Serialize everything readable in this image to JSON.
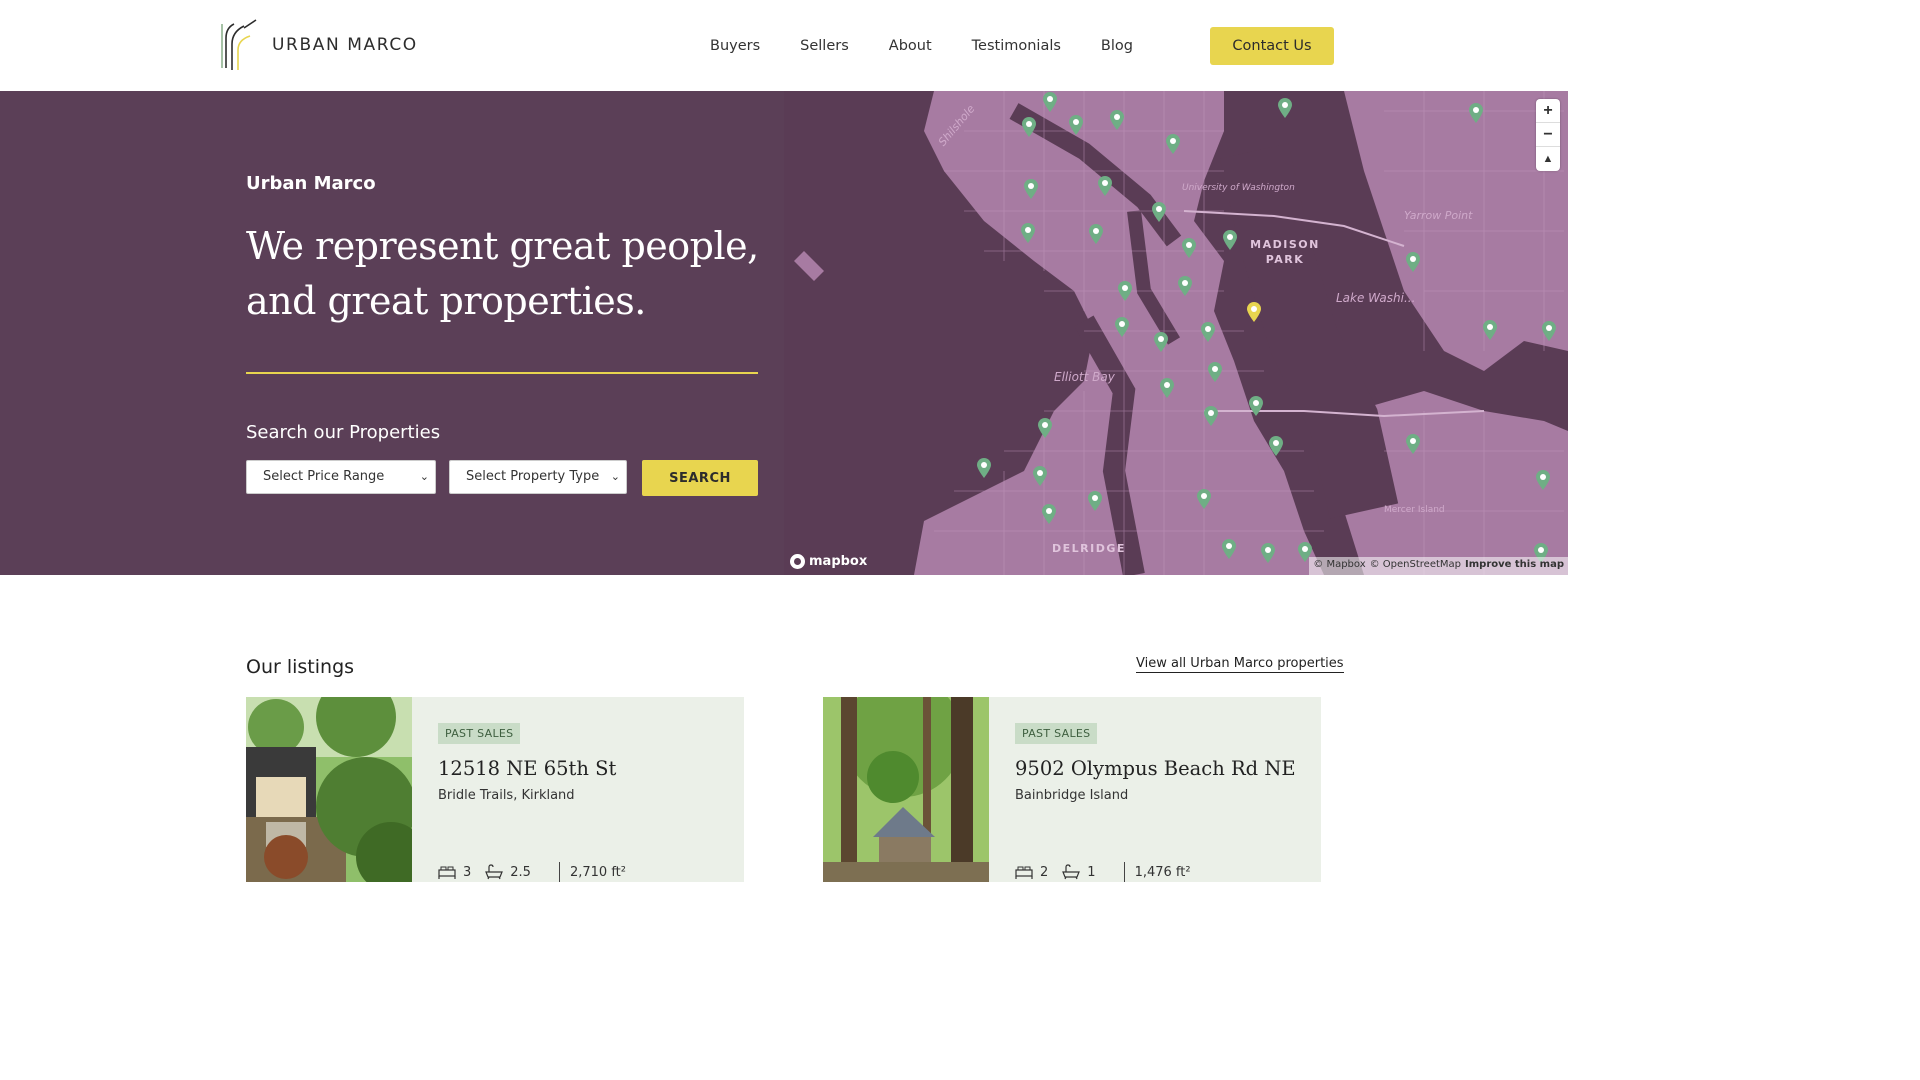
{
  "header": {
    "logo_text": "URBAN MARCO",
    "nav": [
      "Buyers",
      "Sellers",
      "About",
      "Testimonials",
      "Blog"
    ],
    "contact_label": "Contact Us"
  },
  "hero": {
    "brand": "Urban Marco",
    "headline": "We represent great people, and great properties.",
    "search_title": "Search our Properties",
    "price_select": "Select Price Range",
    "type_select": "Select Property Type",
    "search_label": "SEARCH"
  },
  "map": {
    "labels": {
      "shilshole": "Shilshole",
      "uw": "University of Washington",
      "madison_park": "MADISON PARK",
      "yarrow": "Yarrow Point",
      "lake_wash": "Lake Washi...",
      "elliott": "Elliott Bay",
      "delridge": "DELRIDGE",
      "mercer": "Mercer Island"
    },
    "zoom_in": "+",
    "zoom_out": "−",
    "compass": "▲",
    "mapbox": "mapbox",
    "attrib_mapbox": "© Mapbox",
    "attrib_osm": "© OpenStreetMap",
    "attrib_improve": "Improve this map",
    "pin_color": "#6fae85",
    "active_pin_color": "#e8d54f"
  },
  "listings": {
    "title": "Our listings",
    "view_all": "View all Urban Marco properties",
    "cards": [
      {
        "badge": "PAST SALES",
        "address": "12518 NE 65th St",
        "location": "Bridle Trails, Kirkland",
        "beds": "3",
        "baths": "2.5",
        "area": "2,710 ft²"
      },
      {
        "badge": "PAST SALES",
        "address": "9502 Olympus Beach Rd NE",
        "location": "Bainbridge Island",
        "beds": "2",
        "baths": "1",
        "area": "1,476 ft²"
      }
    ]
  }
}
